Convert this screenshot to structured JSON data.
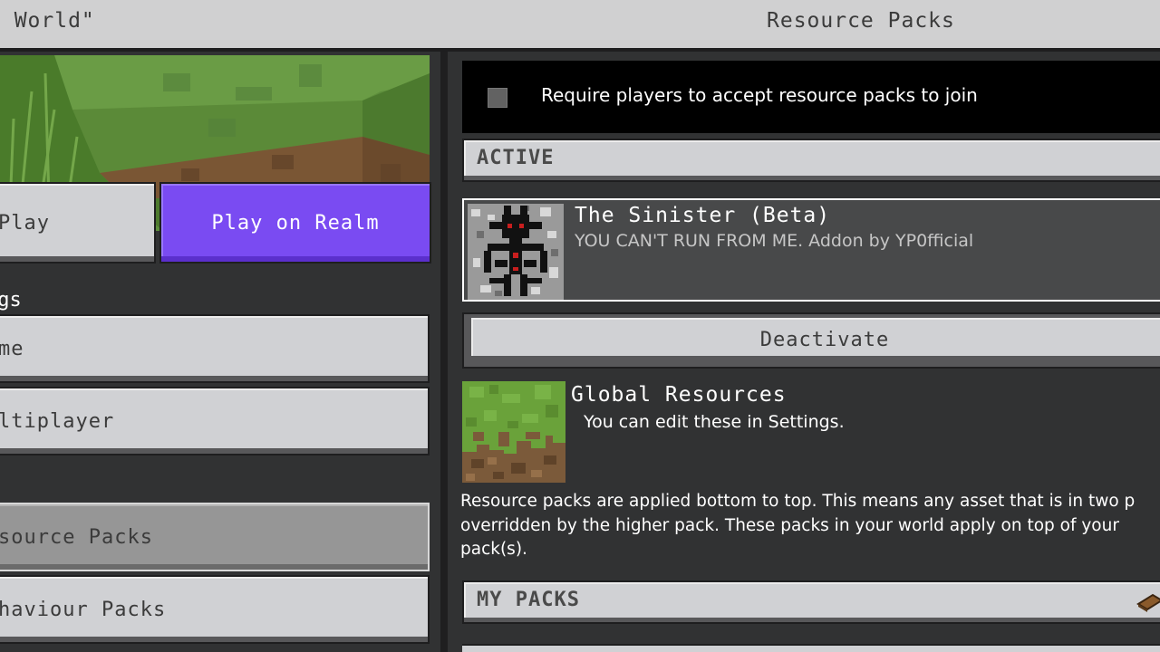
{
  "header": {
    "world_title": "y World\"",
    "screen_title": "Resource Packs"
  },
  "left_panel": {
    "play_label": "Play",
    "play_realm_label": "Play on Realm",
    "settings_heading": "ngs",
    "menu": {
      "game": "me",
      "multiplayer": "ltiplayer",
      "resource_packs": "source Packs",
      "behaviour_packs": "haviour Packs"
    }
  },
  "right_panel": {
    "require_label": "Require players to accept resource packs to join",
    "require_checked": false,
    "active_header": "ACTIVE",
    "active_pack": {
      "name": "The Sinister (Beta)",
      "description": "YOU CAN'T RUN FROM ME. Addon by YP0fficial"
    },
    "deactivate_label": "Deactivate",
    "global_resources": {
      "name": "Global Resources",
      "description": "You can edit these in Settings."
    },
    "info_lines": [
      "Resource packs are applied bottom to top. This means any asset that is in two p",
      "overridden by the higher pack. These packs in your world apply on top of your",
      "pack(s)."
    ],
    "my_packs_header": "MY PACKS"
  },
  "colors": {
    "realm_purple": "#7a4bf2",
    "button_gray": "#d0d1d4",
    "panel_dark": "#313233",
    "selected_gray": "#969696"
  }
}
